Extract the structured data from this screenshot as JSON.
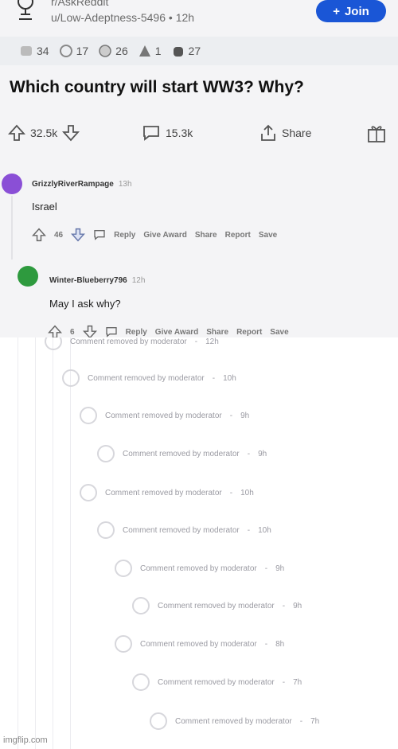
{
  "header": {
    "subreddit": "r/AskReddit",
    "meta_user": "u/Low-Adeptness-5496",
    "meta_sep": "•",
    "meta_time": "12h",
    "join_label": "Join"
  },
  "awards": [
    {
      "icon": "award-icon-1",
      "count": "34"
    },
    {
      "icon": "award-icon-2",
      "count": "17"
    },
    {
      "icon": "award-icon-3",
      "count": "26"
    },
    {
      "icon": "award-icon-4",
      "count": "1"
    },
    {
      "icon": "award-icon-5",
      "count": "27"
    }
  ],
  "post": {
    "title": "Which country will start WW3? Why?",
    "upvotes": "32.5k",
    "comments": "15.3k",
    "share": "Share"
  },
  "comments": [
    {
      "user": "GrizzlyRiverRampage",
      "time": "13h",
      "body": "Israel",
      "votes": "46"
    },
    {
      "user": "Winter-Blueberry796",
      "time": "12h",
      "body": "May I ask why?",
      "votes": "6"
    }
  ],
  "comment_actions": {
    "reply": "Reply",
    "award": "Give Award",
    "share": "Share",
    "report": "Report",
    "save": "Save"
  },
  "removed": [
    {
      "text": "Comment removed by moderator",
      "time": "12h"
    },
    {
      "text": "Comment removed by moderator",
      "time": "10h"
    },
    {
      "text": "Comment removed by moderator",
      "time": "9h"
    },
    {
      "text": "Comment removed by moderator",
      "time": "9h"
    },
    {
      "text": "Comment removed by moderator",
      "time": "10h"
    },
    {
      "text": "Comment removed by moderator",
      "time": "10h"
    },
    {
      "text": "Comment removed by moderator",
      "time": "9h"
    },
    {
      "text": "Comment removed by moderator",
      "time": "9h"
    },
    {
      "text": "Comment removed by moderator",
      "time": "8h"
    },
    {
      "text": "Comment removed by moderator",
      "time": "7h"
    },
    {
      "text": "Comment removed by moderator",
      "time": "7h"
    }
  ],
  "removed_sep": "-",
  "watermark": "imgflip.com",
  "colors": {
    "join": "#1a56d6",
    "avatar1": "#8a4fd6",
    "avatar2": "#2e9a3e"
  }
}
